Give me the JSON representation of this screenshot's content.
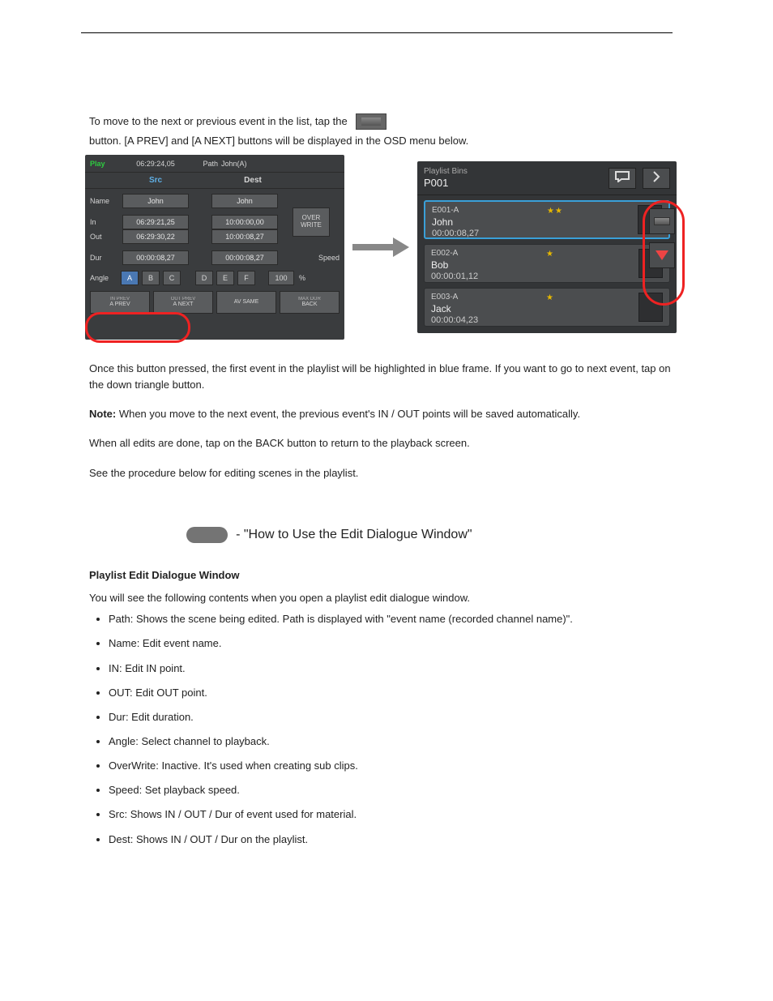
{
  "intro": {
    "text_before": "To move to the next or previous event in the list, tap the",
    "text_after": "button. [A PREV] and [A NEXT] buttons will be displayed in the OSD menu below."
  },
  "left_panel": {
    "play_label": "Play",
    "timecode": "06:29:24,05",
    "path_label": "Path",
    "path_value": "John(A)",
    "src_label": "Src",
    "dest_label": "Dest",
    "rows": {
      "name": {
        "label": "Name",
        "src": "John",
        "dst": "John"
      },
      "in": {
        "label": "In",
        "src": "06:29:21,25",
        "dst": "10:00:00,00"
      },
      "out": {
        "label": "Out",
        "src": "06:29:30,22",
        "dst": "10:00:08,27"
      },
      "dur": {
        "label": "Dur",
        "src": "00:00:08,27",
        "dst": "00:00:08,27"
      }
    },
    "overwrite": "OVER WRITE",
    "angle_label": "Angle",
    "angles_src": [
      "A",
      "B",
      "C"
    ],
    "angles_dst": [
      "D",
      "E",
      "F"
    ],
    "speed_label": "Speed",
    "speed_value": "100",
    "speed_unit": "%",
    "bottom": {
      "aprev_sub": "IN PREV",
      "aprev": "A PREV",
      "anext_sub": "OUT PREV",
      "anext": "A NEXT",
      "avsame": "AV SAME",
      "back_sub": "MAX DUR",
      "back": "BACK"
    }
  },
  "right_panel": {
    "title_small": "Playlist Bins",
    "title_big": "P001",
    "bins": [
      {
        "id": "E001-A",
        "name": "John",
        "dur": "00:00:08,27",
        "stars": "★★"
      },
      {
        "id": "E002-A",
        "name": "Bob",
        "dur": "00:00:01,12",
        "stars": "★"
      },
      {
        "id": "E003-A",
        "name": "Jack",
        "dur": "00:00:04,23",
        "stars": "★"
      }
    ]
  },
  "block1": {
    "p1": "Once this button pressed, the first event in the playlist will be highlighted in blue frame. If you want to go to next event, tap on the down triangle button.",
    "note_label": "Note:",
    "note_text": " When you move to the next event, the previous event's IN / OUT points will be saved automatically.",
    "p2": "When all edits are done, tap on the BACK button to return to the playback screen.",
    "p3": "See the procedure below for editing scenes in the playlist.",
    "dash": "- \"How to Use the Edit Dialogue Window\""
  },
  "block2": {
    "heading": "Playlist Edit Dialogue Window",
    "lead": "You will see the following contents when you open a playlist edit dialogue window.",
    "items": [
      {
        "title": "Path",
        "body": ": Shows the scene being edited. Path is displayed with \"event name (recorded channel name)\"."
      },
      {
        "title": "Name",
        "body": ": Edit event name."
      },
      {
        "title": "IN",
        "body": ": Edit IN point."
      },
      {
        "title": "OUT",
        "body": ": Edit OUT point."
      },
      {
        "title": "Dur",
        "body": ": Edit duration."
      },
      {
        "title": "Angle",
        "body": ": Select channel to playback."
      },
      {
        "title": "OverWrite",
        "body": ": Inactive. It's used when creating sub clips."
      },
      {
        "title": "Speed",
        "body": ": Set playback speed."
      },
      {
        "title": "Src",
        "body": ": Shows IN / OUT / Dur of event used for material."
      },
      {
        "title": "Dest",
        "body": ": Shows IN / OUT / Dur on the playlist."
      }
    ]
  }
}
